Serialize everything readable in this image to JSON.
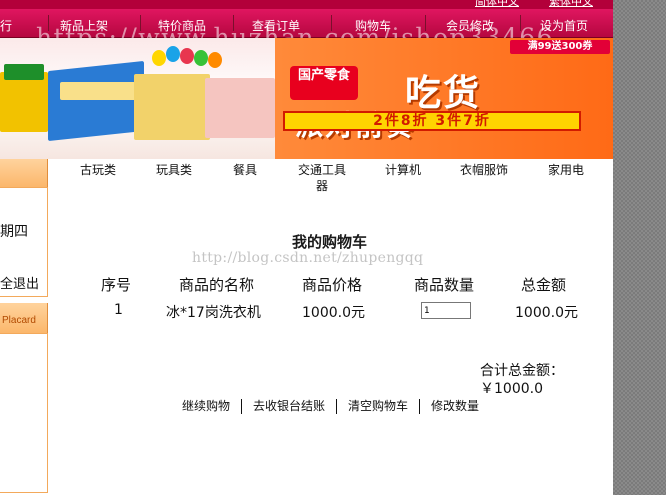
{
  "watermark_top": "https://www.huzhan.com/ishop33466",
  "watermark_mid": "http://blog.csdn.net/zhupengqq",
  "lang_links": [
    "简体中文",
    "繁体中文"
  ],
  "nav": {
    "items": [
      "行",
      "新品上架",
      "特价商品",
      "查看订单",
      "购物车",
      "会员修改",
      "设为首页"
    ]
  },
  "banner": {
    "brand": "国产零食",
    "headline": "吃货",
    "subheadline": "派对前奏",
    "discount": "2件8折 3件7折",
    "corner_offer": "满99送300券"
  },
  "categories": [
    "古玩类",
    "玩具类",
    "餐具",
    "交通工具器",
    "计算机",
    "衣帽服饰",
    "家用电"
  ],
  "sidebar": {
    "day": "期四",
    "logout": "全退出",
    "placard": "Placard"
  },
  "cart": {
    "title": "我的购物车",
    "columns": [
      "序号",
      "商品的名称",
      "商品价格",
      "商品数量",
      "总金额"
    ],
    "rows": [
      {
        "index": "1",
        "name": "冰*17岗洗衣机",
        "price": "1000.0元",
        "quantity": "1",
        "total": "1000.0元"
      }
    ],
    "total_label": "合计总金额：",
    "total_value": "￥1000.0"
  },
  "actions": [
    "继续购物",
    "去收银台结账",
    "清空购物车",
    "修改数量"
  ],
  "colors": {
    "nav": "#c80d4d",
    "banner_orange": "#ff6a16",
    "sidebar_border": "#f3a95b"
  }
}
